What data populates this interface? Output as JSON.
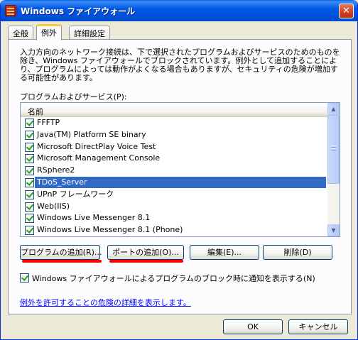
{
  "window": {
    "title": "Windows ファイアウォール",
    "close_glyph": "✕"
  },
  "tabs": [
    {
      "label": "全般"
    },
    {
      "label": "例外"
    },
    {
      "label": "詳細設定"
    }
  ],
  "exceptions": {
    "description": "入力方向のネットワーク接続は、下で選択されたプログラムおよびサービスのためのものを除き、Windows ファイアウォールでブロックされています。例外として追加することにより、プログラムによっては動作がよくなる場合もありますが、セキュリティの危険が増加する可能性があります。",
    "list_label": "プログラムおよびサービス(P):",
    "column_header": "名前",
    "items": [
      {
        "label": "FFFTP",
        "checked": true
      },
      {
        "label": "Java(TM) Platform SE binary",
        "checked": true
      },
      {
        "label": "Microsoft DirectPlay Voice Test",
        "checked": true
      },
      {
        "label": "Microsoft Management Console",
        "checked": true
      },
      {
        "label": "RSphere2",
        "checked": true
      },
      {
        "label": "TDoS_Server",
        "checked": true,
        "selected": true
      },
      {
        "label": "UPnP フレームワーク",
        "checked": true
      },
      {
        "label": "Web(IIS)",
        "checked": true
      },
      {
        "label": "Windows Live Messenger 8.1",
        "checked": true
      },
      {
        "label": "Windows Live Messenger 8.1 (Phone)",
        "checked": true
      }
    ],
    "buttons": {
      "add_program": "プログラムの追加(R)...",
      "add_port": "ポートの追加(O)...",
      "edit": "編集(E)...",
      "delete": "削除(D)"
    },
    "notify_checkbox": {
      "label": "Windows ファイアウォールによるプログラムのブロック時に通知を表示する(N)",
      "checked": true
    },
    "risk_link": "例外を許可することの危険の詳細を表示します。"
  },
  "footer": {
    "ok": "OK",
    "cancel": "キャンセル"
  },
  "colors": {
    "titlebar": "#0058e6",
    "selection": "#316ac5",
    "annotation_underline": "#ff0000",
    "active_tab_accent": "#ffc83c"
  }
}
